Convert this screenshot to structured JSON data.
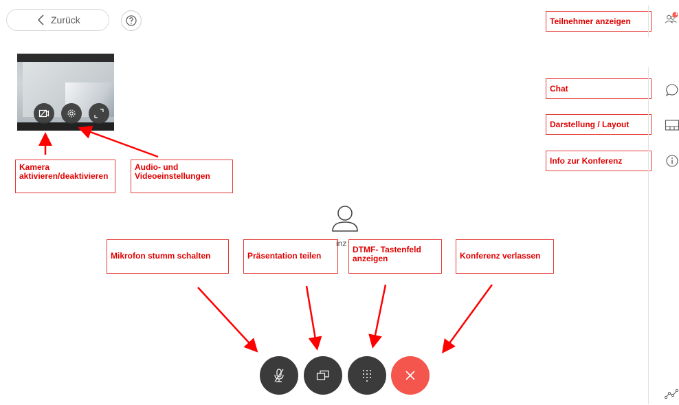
{
  "header": {
    "back_label": "Zurück",
    "help_icon": "question-circle-icon"
  },
  "participant": {
    "name_fragment": "inz"
  },
  "annotations": {
    "camera": "Kamera\naktivieren/deaktivieren",
    "av_settings": "Audio- und\nVideoeinstellungen",
    "mic": "Mikrofon stumm schalten",
    "presentation": "Präsentation  teilen",
    "dtmf": "DTMF- Tastenfeld\nanzeigen",
    "leave": "Konferenz verlassen",
    "participants": "Teilnehmer anzeigen",
    "chat": "Chat",
    "layout": "Darstellung / Layout",
    "info": "Info zur Konferenz"
  },
  "sidebar": {
    "participants_badge": "1"
  },
  "colors": {
    "annotation": "#e00000",
    "leave_button": "#f4554c",
    "control_button": "#3b3b3b"
  }
}
